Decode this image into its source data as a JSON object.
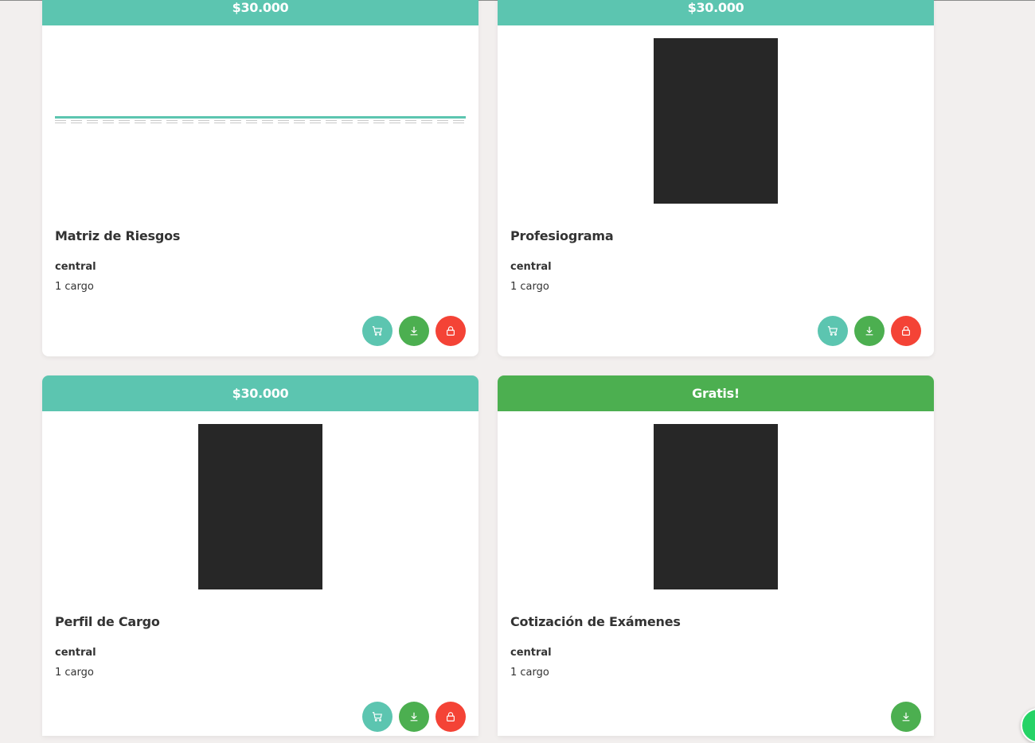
{
  "colors": {
    "paid_header": "#5cc5b0",
    "free_header": "#4caf50",
    "cart_button": "#5cc5b0",
    "download_button": "#4caf50",
    "lock_button": "#f44336",
    "page_background": "#f2efee"
  },
  "cards": [
    {
      "price": "$30.000",
      "title": "Matriz de Riesgos",
      "owner": "central",
      "count": "1 cargo",
      "preview": "spreadsheet-thumbnail",
      "actions": [
        "cart-icon",
        "download-icon",
        "lock-icon"
      ]
    },
    {
      "price": "$30.000",
      "title": "Profesiograma",
      "owner": "central",
      "count": "1 cargo",
      "preview": "document-thumbnail",
      "actions": [
        "cart-icon",
        "download-icon",
        "lock-icon"
      ]
    },
    {
      "price": "$30.000",
      "title": "Perfil de Cargo",
      "owner": "central",
      "count": "1 cargo",
      "preview": "document-thumbnail",
      "actions": [
        "cart-icon",
        "download-icon",
        "lock-icon"
      ]
    },
    {
      "price": "Gratis!",
      "title": "Cotización de Exámenes",
      "owner": "central",
      "count": "1 cargo",
      "preview": "document-thumbnail",
      "actions": [
        "download-icon"
      ]
    }
  ],
  "floating": {
    "icon": "whatsapp-icon"
  }
}
